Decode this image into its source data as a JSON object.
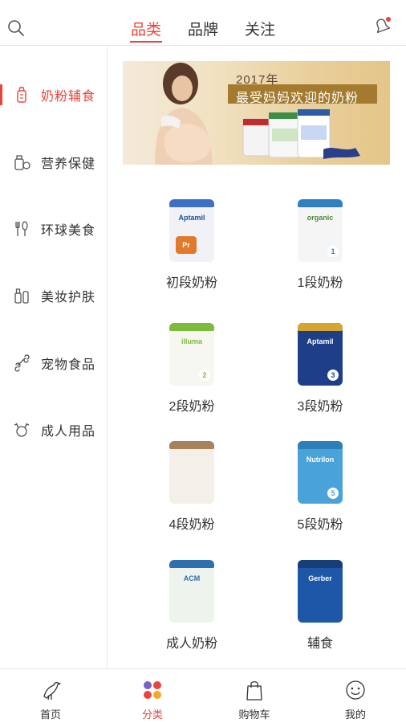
{
  "header": {
    "tabs": [
      {
        "label": "品类"
      },
      {
        "label": "品牌"
      },
      {
        "label": "关注"
      }
    ],
    "active_tab": "品类",
    "icons": {
      "search": "search-icon",
      "notification": "bell-icon"
    }
  },
  "sidebar": {
    "items": [
      {
        "label": "奶粉辅食",
        "icon": "baby-bottle-icon"
      },
      {
        "label": "营养保健",
        "icon": "supplement-icon"
      },
      {
        "label": "环球美食",
        "icon": "fork-spoon-icon"
      },
      {
        "label": "美妆护肤",
        "icon": "cosmetics-icon"
      },
      {
        "label": "宠物食品",
        "icon": "bone-icon"
      },
      {
        "label": "成人用品",
        "icon": "gender-icon"
      }
    ],
    "active_item": "奶粉辅食"
  },
  "banner": {
    "year": "2017年",
    "headline": "最受妈妈欢迎的奶粉"
  },
  "products": [
    {
      "name": "初段奶粉",
      "brand": "Aptamil",
      "num": "Pr",
      "color": "#3d6fc4"
    },
    {
      "name": "1段奶粉",
      "brand": "organic",
      "num": "1",
      "color": "#2f7fc1"
    },
    {
      "name": "2段奶粉",
      "brand": "illuma",
      "num": "2",
      "color": "#7dbb3c"
    },
    {
      "name": "3段奶粉",
      "brand": "Aptamil",
      "num": "3",
      "color": "#1e3f88"
    },
    {
      "name": "4段奶粉",
      "brand": "",
      "num": "",
      "color": "#a8835a"
    },
    {
      "name": "5段奶粉",
      "brand": "Nutrilon",
      "num": "5",
      "color": "#4aa3d8"
    },
    {
      "name": "成人奶粉",
      "brand": "ACM",
      "num": "",
      "color": "#2f6fb0"
    },
    {
      "name": "辅食",
      "brand": "Gerber",
      "num": "",
      "color": "#1e57a8"
    }
  ],
  "bottom_nav": {
    "items": [
      {
        "label": "首页",
        "icon": "bird-icon"
      },
      {
        "label": "分类",
        "icon": "category-dots-icon"
      },
      {
        "label": "购物车",
        "icon": "shopping-bag-icon"
      },
      {
        "label": "我的",
        "icon": "smiley-icon"
      }
    ],
    "active_item": "分类"
  },
  "colors": {
    "accent": "#e8453c",
    "text": "#333333",
    "divider": "#e6e6e6"
  }
}
